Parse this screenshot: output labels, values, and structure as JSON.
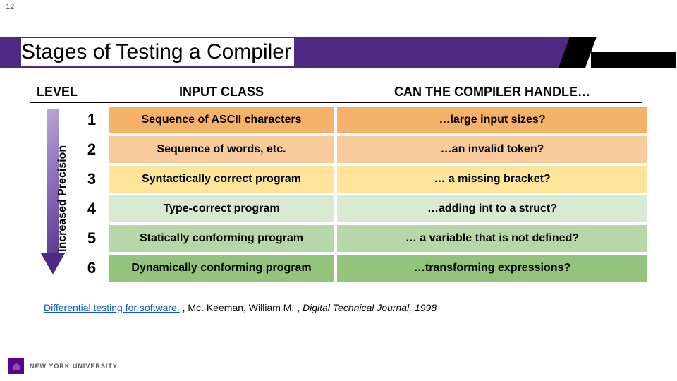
{
  "page_number": "12",
  "title": "Stages of Testing a Compiler",
  "headers": {
    "level": "LEVEL",
    "input_class": "INPUT CLASS",
    "handle": "CAN THE COMPILER HANDLE…"
  },
  "arrow_label": "Increased Precision",
  "rows": [
    {
      "num": "1",
      "input": "Sequence of ASCII characters",
      "handle": "…large input sizes?",
      "color": "#f6b26b"
    },
    {
      "num": "2",
      "input": "Sequence of words, etc.",
      "handle": "…an invalid token?",
      "color": "#f9cb9c"
    },
    {
      "num": "3",
      "input": "Syntactically correct program",
      "handle": "… a missing bracket?",
      "color": "#ffe599"
    },
    {
      "num": "4",
      "input": "Type-correct program",
      "handle": "…adding int to a struct?",
      "color": "#d9ead3"
    },
    {
      "num": "5",
      "input": "Statically conforming program",
      "handle": "… a variable that is not defined?",
      "color": "#b6d7a8"
    },
    {
      "num": "6",
      "input": "Dynamically conforming program",
      "handle": "…transforming expressions?",
      "color": "#93c47d"
    }
  ],
  "reference": {
    "link_text": "Differential testing for software.",
    "rest": " , Mc. Keeman, William M. , ",
    "journal": "Digital Technical Journal, 1998"
  },
  "footer_org": "NEW YORK UNIVERSITY"
}
